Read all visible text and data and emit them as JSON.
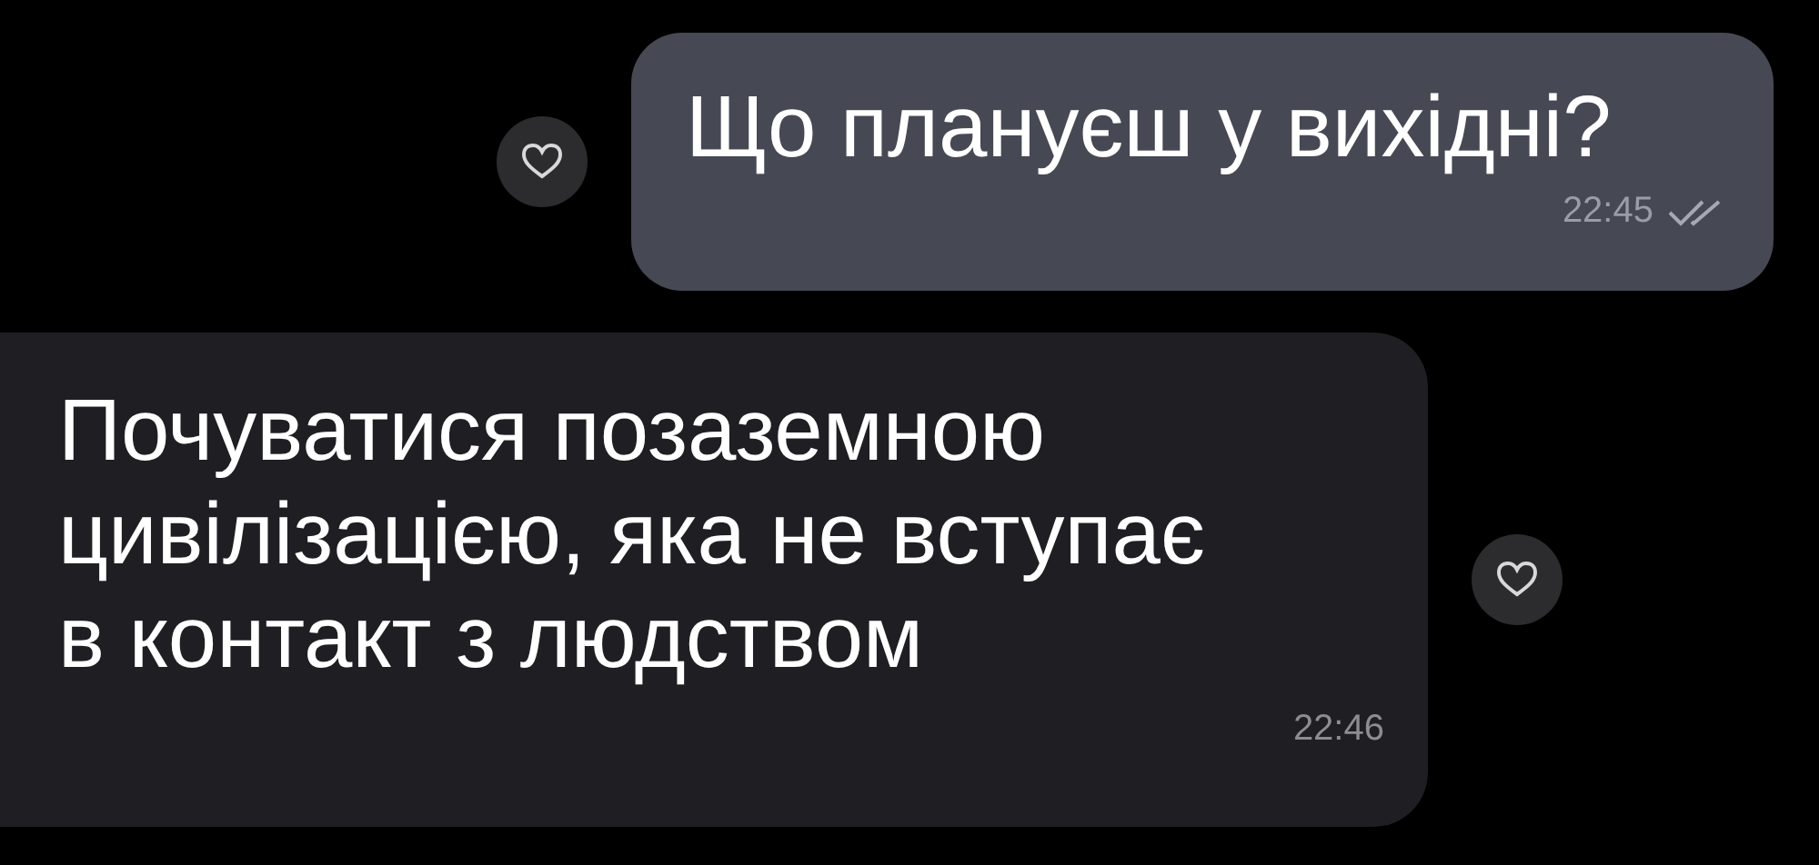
{
  "messages": [
    {
      "kind": "outgoing",
      "text": "Що плануєш у вихідні?",
      "time": "22:45",
      "read": true
    },
    {
      "kind": "incoming",
      "text": "Почуватися позаземною цивілізацією, яка не вступає в контакт з людством",
      "time": "22:46"
    }
  ]
}
